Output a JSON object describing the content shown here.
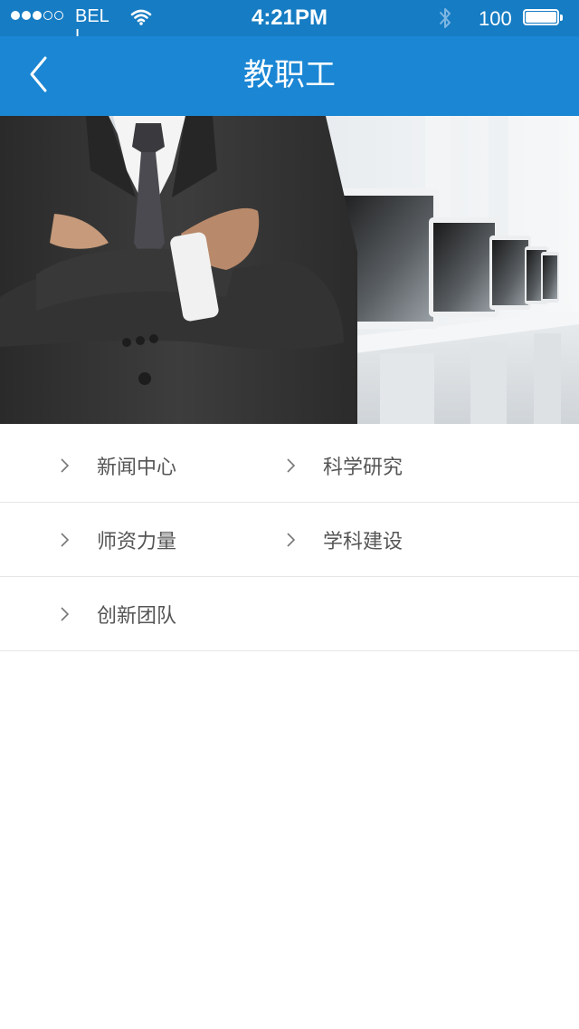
{
  "status_bar": {
    "carrier": "BELL",
    "time": "4:21PM",
    "battery": "100",
    "signal_bars_filled": 3,
    "signal_bars_total": 5
  },
  "nav": {
    "title": "教职工",
    "back_icon": "chevron-left-icon"
  },
  "menu": {
    "rows": [
      [
        {
          "label": "新闻中心"
        },
        {
          "label": "科学研究"
        }
      ],
      [
        {
          "label": "师资力量"
        },
        {
          "label": "学科建设"
        }
      ],
      [
        {
          "label": "创新团队"
        }
      ]
    ]
  },
  "colors": {
    "status_bar": "#167cc3",
    "nav_bar": "#1a86d4",
    "label": "#555555",
    "divider": "#e6e6e6"
  }
}
